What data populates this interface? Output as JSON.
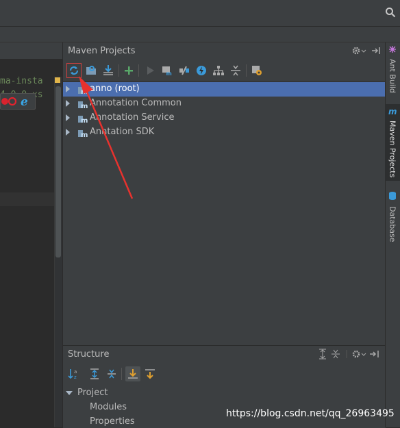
{
  "editor": {
    "code_line_1": "ma-insta",
    "code_line_2": "4.0.0.xs"
  },
  "maven": {
    "title": "Maven Projects",
    "toolbar": [
      {
        "name": "reimport-all-icon"
      },
      {
        "name": "generate-sources-icon"
      },
      {
        "name": "download-sources-icon"
      },
      {
        "name": "add-project-icon"
      },
      {
        "name": "run-build-icon"
      },
      {
        "name": "execute-goal-icon"
      },
      {
        "name": "toggle-offline-icon"
      },
      {
        "name": "skip-tests-icon"
      },
      {
        "name": "show-dependencies-icon"
      },
      {
        "name": "collapse-all-icon"
      },
      {
        "name": "maven-settings-icon"
      }
    ],
    "projects": [
      {
        "label": "anno (root)",
        "selected": true
      },
      {
        "label": "Annotation Common",
        "selected": false
      },
      {
        "label": "Annotation Service",
        "selected": false
      },
      {
        "label": "Anntation SDK",
        "selected": false
      }
    ]
  },
  "structure": {
    "title": "Structure",
    "tree": {
      "root": "Project",
      "children": [
        "Modules",
        "Properties"
      ]
    }
  },
  "right_strip": {
    "tabs": [
      "Ant Build",
      "Maven Projects",
      "Database"
    ]
  },
  "colors": {
    "background": "#2b2b2b",
    "panel": "#3c3f41",
    "selection": "#4b6eaf",
    "annotation": "#e8322e"
  },
  "watermark": "https://blog.csdn.net/qq_26963495"
}
